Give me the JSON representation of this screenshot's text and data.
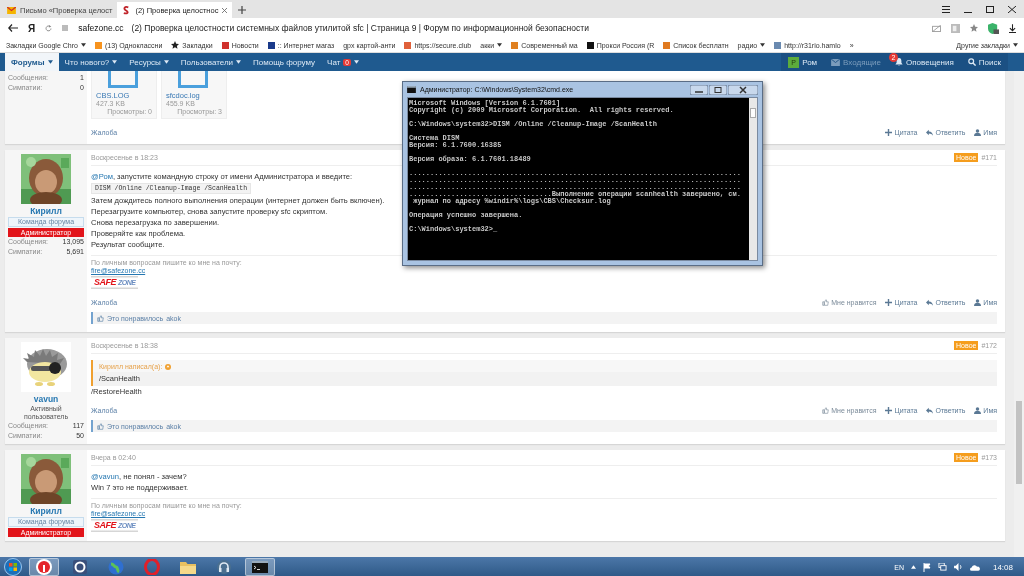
{
  "browser": {
    "tabs": [
      {
        "title": "Письмо «Проверка целост",
        "selected": false,
        "kind": "mail"
      },
      {
        "title": "(2) Проверка целостнос",
        "selected": true,
        "kind": "site"
      }
    ],
    "address": {
      "logo": "Я",
      "domain": "safezone.cc",
      "page_title": "(2) Проверка целостности системных файлов утилитой sfc | Страница 9 | Форум по информационной безопасности"
    },
    "bookmarks": [
      {
        "label": "Закладки Google Chro",
        "kind": "folder"
      },
      {
        "label": "(13) Одноклассни",
        "kind": "site",
        "color": "#f7931e"
      },
      {
        "label": "Закладки",
        "kind": "star"
      },
      {
        "label": "Новости",
        "kind": "site",
        "color": "#d0312d"
      },
      {
        "label": ":: Интернет магаз",
        "kind": "site",
        "color": "#1a3a8a"
      },
      {
        "label": "gpx картой-анти",
        "kind": "plain"
      },
      {
        "label": "https://secure.club",
        "kind": "site",
        "color": "#e0603a"
      },
      {
        "label": "акки",
        "kind": "folder"
      },
      {
        "label": "Современный ма",
        "kind": "site",
        "color": "#e08020"
      },
      {
        "label": "Прокси Россия (R",
        "kind": "site",
        "color": "#111111"
      },
      {
        "label": "Список бесплатн",
        "kind": "site",
        "color": "#e07a20"
      },
      {
        "label": "радио",
        "kind": "folder"
      },
      {
        "label": "http://r31rio.hamlo",
        "kind": "site",
        "color": "#6a8ab0"
      }
    ],
    "more": "»",
    "other_bookmarks": "Другие закладки"
  },
  "forum_nav": {
    "items": [
      {
        "label": "Форумы",
        "selected": true,
        "dropdown": true
      },
      {
        "label": "Что нового?",
        "selected": false,
        "dropdown": true
      },
      {
        "label": "Ресурсы",
        "selected": false,
        "dropdown": true
      },
      {
        "label": "Пользователи",
        "selected": false,
        "dropdown": true
      },
      {
        "label": "Помощь форуму",
        "selected": false,
        "dropdown": false
      },
      {
        "label": "Чат",
        "selected": false,
        "dropdown": true,
        "badge": "0"
      }
    ],
    "user": {
      "avatar_letter": "Р",
      "name": "Ром"
    },
    "inbox": {
      "label": "Входящие",
      "disabled": true
    },
    "alerts": {
      "label": "Оповещения",
      "badge": "2"
    },
    "search": "Поиск"
  },
  "posts": [
    {
      "stats": [
        {
          "label": "Сообщения:",
          "value": "1"
        },
        {
          "label": "Симпатии:",
          "value": "0"
        }
      ],
      "attachments": [
        {
          "name": "CBS.LOG",
          "size": "427.3 KB",
          "views": "Просмотры: 0"
        },
        {
          "name": "sfcdoc.log",
          "size": "455.9 KB",
          "views": "Просмотры: 3"
        }
      ],
      "report": "Жалоба",
      "actions": [
        {
          "kind": "quote",
          "label": "Цитата"
        },
        {
          "kind": "reply",
          "label": "Ответить"
        },
        {
          "kind": "name",
          "label": "Имя"
        }
      ]
    },
    {
      "author": "Кирилл",
      "staff": true,
      "user_title": "Команда форума",
      "banner": "Администратор",
      "stats": [
        {
          "label": "Сообщения:",
          "value": "13,095"
        },
        {
          "label": "Симпатии:",
          "value": "5,691"
        }
      ],
      "date": "Воскресенье в 18:23",
      "new_badge": "Новое",
      "number": "#171",
      "body": [
        {
          "kind": "text",
          "mention": "@Ром",
          "text": ", запустите командную строку от имени Администратора и введите:"
        },
        {
          "kind": "code",
          "text": "DISM /Online /Cleanup-Image /ScanHealth"
        },
        {
          "kind": "text",
          "text": "Затем дождитесь полного выполнения операции (интернет должен быть включен)."
        },
        {
          "kind": "text",
          "text": "Перезагрузите компьютер, снова запустите проверку sfc скриптом."
        },
        {
          "kind": "text",
          "text": "Снова перезагрузка по завершении."
        },
        {
          "kind": "text",
          "text": "Проверяйте как проблема."
        },
        {
          "kind": "text",
          "text": "Результат сообщите."
        }
      ],
      "signature": {
        "note": "По личным вопросам пишите ко мне на почту:",
        "email": "fire@safezone.cc",
        "logo": [
          "SAFE",
          "ZONE"
        ]
      },
      "report": "Жалоба",
      "actions": [
        {
          "kind": "like",
          "label": "Мне нравится"
        },
        {
          "kind": "quote",
          "label": "Цитата"
        },
        {
          "kind": "reply",
          "label": "Ответить"
        },
        {
          "kind": "name",
          "label": "Имя"
        }
      ],
      "likes": {
        "text": "Это понравилось",
        "user": "akok"
      }
    },
    {
      "author": "vavun",
      "staff": false,
      "user_title": "Активный пользователь",
      "stats": [
        {
          "label": "Сообщения:",
          "value": "117"
        },
        {
          "label": "Симпатии:",
          "value": "50"
        }
      ],
      "date": "Воскресенье в 18:38",
      "new_badge": "Новое",
      "number": "#172",
      "quote": {
        "author": "Кирилл написал(а):",
        "text": "/ScanHealth"
      },
      "body": [
        {
          "kind": "text",
          "text": "/RestoreHealth"
        }
      ],
      "report": "Жалоба",
      "actions": [
        {
          "kind": "like",
          "label": "Мне нравится"
        },
        {
          "kind": "quote",
          "label": "Цитата"
        },
        {
          "kind": "reply",
          "label": "Ответить"
        },
        {
          "kind": "name",
          "label": "Имя"
        }
      ],
      "likes": {
        "text": "Это понравилось",
        "user": "akok"
      }
    },
    {
      "author": "Кирилл",
      "staff": true,
      "user_title": "Команда форума",
      "banner": "Администратор",
      "date": "Вчера в 02:40",
      "new_badge": "Новое",
      "number": "#173",
      "body": [
        {
          "kind": "text",
          "mention": "@vavun",
          "text": ", не понял - зачем?"
        },
        {
          "kind": "text",
          "text": "Win 7 это не поддерживает."
        }
      ],
      "signature": {
        "note": "По личным вопросам пишите ко мне на почту:",
        "email": "fire@safezone.cc",
        "logo": [
          "SAFE",
          "ZONE"
        ]
      }
    }
  ],
  "console": {
    "title": "Администратор: C:\\Windows\\System32\\cmd.exe",
    "blocks": [
      [
        "Microsoft Windows [Version 6.1.7601]",
        "Copyright (c) 2009 Microsoft Corporation.  All rights reserved."
      ],
      [
        "C:\\Windows\\system32>DISM /Online /Cleanup-Image /ScanHealth"
      ],
      [
        "Система DISM",
        "Версия: 6.1.7600.16385"
      ],
      [
        "Версия образа: 6.1.7601.18489"
      ],
      [
        "...............................................................................",
        "...............................................................................",
        "...............................................................................",
        "..................................Выполнение операции scanhealth завершено, см.",
        " журнал по адресу %windir%\\logs\\CBS\\Checksur.log"
      ],
      [
        "Операция успешно завершена."
      ],
      [
        "C:\\Windows\\system32>_"
      ]
    ]
  },
  "taskbar": {
    "apps": [
      {
        "kind": "browser",
        "open": true
      },
      {
        "kind": "mail",
        "open": false
      },
      {
        "kind": "globe",
        "open": false
      },
      {
        "kind": "ring",
        "open": false
      },
      {
        "kind": "folder",
        "open": false
      },
      {
        "kind": "headset",
        "open": false
      },
      {
        "kind": "terminal",
        "open": true
      }
    ],
    "language": "EN",
    "time": "14:08"
  }
}
